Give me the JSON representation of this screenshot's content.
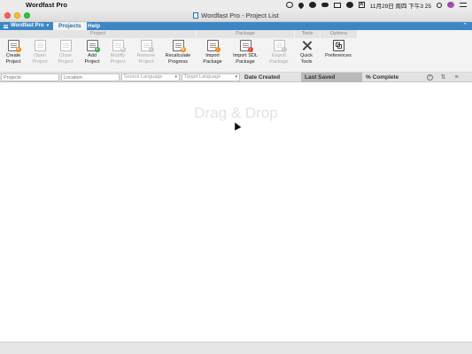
{
  "menubar": {
    "app_name": "Wordfast Pro",
    "clock": "11月29日 周四 下午3 25"
  },
  "window": {
    "title": "Wordfast Pro - Project List"
  },
  "ribbon": {
    "app_menu_label": "Wordfast Pro",
    "tabs": [
      {
        "label": "Projects",
        "active": true
      },
      {
        "label": "Help",
        "active": false
      }
    ],
    "groups": [
      {
        "label": "Project"
      },
      {
        "label": "Package"
      },
      {
        "label": "Tools"
      },
      {
        "label": "Options"
      }
    ],
    "buttons": [
      {
        "line1": "Create",
        "line2": "Project",
        "enabled": true,
        "icon": "create-project-icon"
      },
      {
        "line1": "Open",
        "line2": "Project",
        "enabled": false,
        "icon": "open-project-icon"
      },
      {
        "line1": "Close",
        "line2": "Project",
        "enabled": false,
        "icon": "close-project-icon"
      },
      {
        "line1": "Add",
        "line2": "Project",
        "enabled": true,
        "icon": "add-project-icon"
      },
      {
        "line1": "Modify",
        "line2": "Project",
        "enabled": false,
        "icon": "modify-project-icon"
      },
      {
        "line1": "Remove",
        "line2": "Project",
        "enabled": false,
        "icon": "remove-project-icon"
      },
      {
        "line1": "Recalculate",
        "line2": "Progress",
        "enabled": true,
        "icon": "recalculate-progress-icon"
      },
      {
        "line1": "Import",
        "line2": "Package",
        "enabled": true,
        "icon": "import-package-icon"
      },
      {
        "line1": "Import SDL",
        "line2": "Package",
        "enabled": true,
        "icon": "import-sdl-package-icon"
      },
      {
        "line1": "Export",
        "line2": "Package",
        "enabled": false,
        "icon": "export-package-icon"
      },
      {
        "line1": "Quick",
        "line2": "Tools",
        "enabled": true,
        "icon": "quick-tools-icon"
      },
      {
        "line1": "Preferences",
        "line2": "",
        "enabled": true,
        "icon": "preferences-icon"
      }
    ]
  },
  "filters": {
    "projects_placeholder": "Projects",
    "location_placeholder": "Location",
    "source_language": "Source Language",
    "target_language": "Target Language"
  },
  "columns": {
    "date_created": "Date Created",
    "last_saved": "Last Saved",
    "percent_complete": "% Complete"
  },
  "content": {
    "empty_hint": "Drag & Drop"
  },
  "colors": {
    "ribbon_blue": "#3d86c6",
    "sorted_column": "#b9b9b9"
  }
}
